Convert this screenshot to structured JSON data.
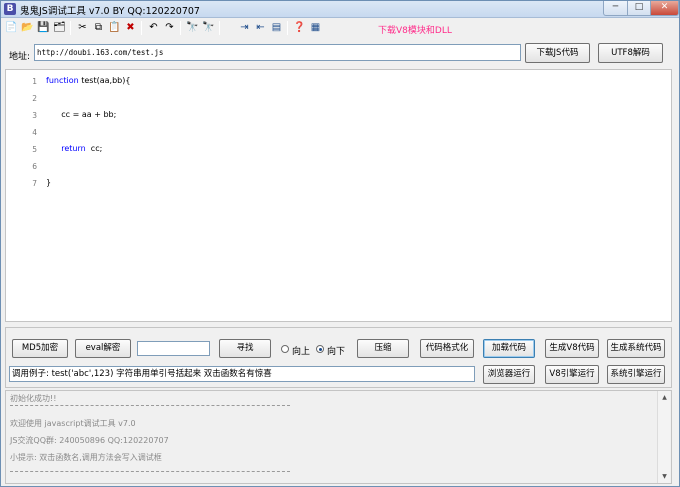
{
  "window": {
    "app_icon_letter": "B",
    "title": "鬼鬼JS调试工具 v7.0 BY QQ:120220707",
    "min_glyph": "─",
    "max_glyph": "□",
    "close_glyph": "✕"
  },
  "toolbar": {
    "icons": {
      "new": "📄",
      "open": "📂",
      "save": "💾",
      "save_all": "🗂",
      "cut": "✂",
      "copy": "⧉",
      "paste": "📋",
      "delete": "✖",
      "undo": "↶",
      "redo": "↷",
      "find": "🔭",
      "find_next": "🔭",
      "indent": "⇥",
      "outdent": "⇤",
      "format": "▤",
      "help": "❓",
      "info": "▦"
    },
    "download_link": "下载V8模块和DLL"
  },
  "address": {
    "label": "地址:",
    "value": "http://doubi.163.com/test.js",
    "download_js_button": "下载JS代码",
    "utf8_decode_button": "UTF8解码"
  },
  "editor": {
    "lines": [
      {
        "num": "1",
        "kw": "function",
        "text": " test(aa,bb){"
      },
      {
        "num": "2",
        "kw": "",
        "text": ""
      },
      {
        "num": "3",
        "kw": "",
        "text": "      cc = aa + bb;"
      },
      {
        "num": "4",
        "kw": "",
        "text": ""
      },
      {
        "num": "5",
        "kw": "      return",
        "text": "  cc;"
      },
      {
        "num": "6",
        "kw": "",
        "text": ""
      },
      {
        "num": "7",
        "kw": "",
        "text": "}"
      }
    ]
  },
  "controls": {
    "md5_button": "MD5加密",
    "eval_button": "eval解密",
    "search_value": "",
    "find_button": "寻找",
    "radio_up": "向上",
    "radio_down": "向下",
    "radio_selected": "down",
    "compress_button": "压缩",
    "format_button": "代码格式化",
    "load_button": "加载代码",
    "gen_v8_button": "生成V8代码",
    "gen_sys_button": "生成系统代码",
    "call_example": "调用例子: test('abc',123) 字符串用单引号括起来 双击函数名有惊喜",
    "browser_run_button": "浏览器运行",
    "v8_run_button": "V8引擎运行",
    "sys_run_button": "系统引擎运行"
  },
  "output": {
    "lines": [
      "初始化成功!!",
      "欢迎使用 javascript调试工具 v7.0",
      "JS交流QQ群: 240050896  QQ:120220707",
      "小提示: 双击函数名,调用方法会写入调试框"
    ],
    "scroll_up": "▲",
    "scroll_down": "▼"
  }
}
